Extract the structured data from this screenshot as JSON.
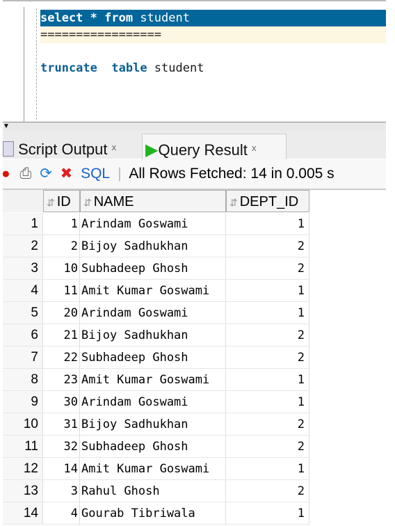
{
  "editor": {
    "line1_kw1": "select",
    "line1_rest": " * ",
    "line1_kw2": "from",
    "line1_tail": " student",
    "line2": "=================",
    "line4_kw1": "truncate",
    "line4_kw2": "table",
    "line4_tail": " student"
  },
  "tabs": [
    {
      "label": "Script Output",
      "close": "x",
      "icon": "script-icon"
    },
    {
      "label": "Query Result",
      "close": "x",
      "icon": "play-icon"
    }
  ],
  "toolbar": {
    "sql_label": "SQL",
    "status": "All Rows Fetched: 14 in 0.005 s",
    "icons": [
      "pin-icon",
      "print-icon",
      "refresh-icon",
      "delete-icon"
    ]
  },
  "columns": [
    "ID",
    "NAME",
    "DEPT_ID"
  ],
  "rows": [
    {
      "n": "1",
      "id": "1",
      "name": "Arindam Goswami",
      "dept": "1"
    },
    {
      "n": "2",
      "id": "2",
      "name": "Bijoy Sadhukhan",
      "dept": "2"
    },
    {
      "n": "3",
      "id": "10",
      "name": "Subhadeep Ghosh",
      "dept": "2"
    },
    {
      "n": "4",
      "id": "11",
      "name": "Amit Kumar Goswami",
      "dept": "1"
    },
    {
      "n": "5",
      "id": "20",
      "name": "Arindam Goswami",
      "dept": "1"
    },
    {
      "n": "6",
      "id": "21",
      "name": "Bijoy Sadhukhan",
      "dept": "2"
    },
    {
      "n": "7",
      "id": "22",
      "name": "Subhadeep Ghosh",
      "dept": "2"
    },
    {
      "n": "8",
      "id": "23",
      "name": "Amit Kumar Goswami",
      "dept": "1"
    },
    {
      "n": "9",
      "id": "30",
      "name": "Arindam Goswami",
      "dept": "1"
    },
    {
      "n": "10",
      "id": "31",
      "name": "Bijoy Sadhukhan",
      "dept": "2"
    },
    {
      "n": "11",
      "id": "32",
      "name": "Subhadeep Ghosh",
      "dept": "2"
    },
    {
      "n": "12",
      "id": "14",
      "name": "Amit Kumar Goswami",
      "dept": "1"
    },
    {
      "n": "13",
      "id": "3",
      "name": "Rahul Ghosh",
      "dept": "2"
    },
    {
      "n": "14",
      "id": "4",
      "name": "Gourab Tibriwala",
      "dept": "1"
    }
  ]
}
